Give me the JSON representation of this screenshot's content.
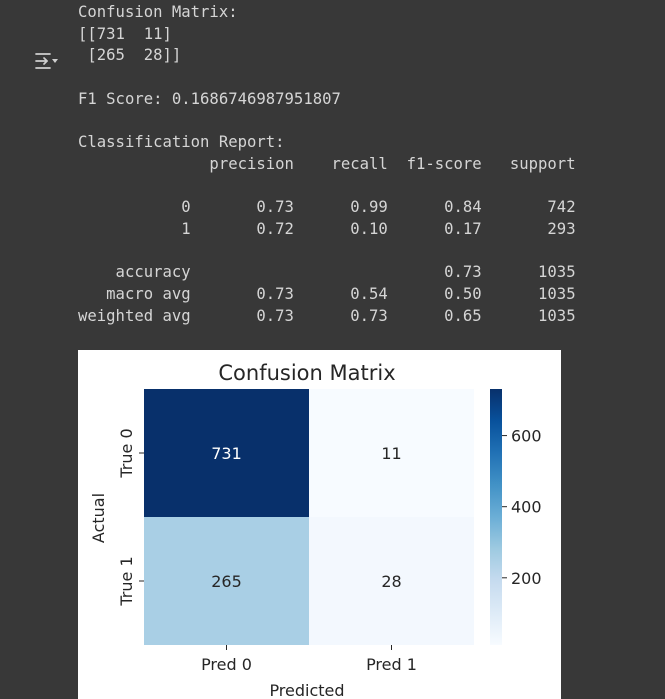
{
  "output_toggle": {
    "icon": "output-toggle-icon"
  },
  "output": {
    "cm_title": "Confusion Matrix:",
    "cm_row1": "[[731  11]",
    "cm_row2": " [265  28]]",
    "f1_line": "F1 Score: 0.1686746987951807",
    "report_title": "Classification Report:",
    "report_header": "              precision    recall  f1-score   support",
    "report_rows": [
      "           0       0.73      0.99      0.84       742",
      "           1       0.72      0.10      0.17       293"
    ],
    "report_summary": [
      "    accuracy                           0.73      1035",
      "   macro avg       0.73      0.54      0.50      1035",
      "weighted avg       0.73      0.73      0.65      1035"
    ]
  },
  "chart_data": {
    "type": "heatmap",
    "title": "Confusion Matrix",
    "xlabel": "Predicted",
    "ylabel": "Actual",
    "x_categories": [
      "Pred 0",
      "Pred 1"
    ],
    "y_categories": [
      "True 0",
      "True 1"
    ],
    "values": [
      [
        731,
        11
      ],
      [
        265,
        28
      ]
    ],
    "colormap": "Blues",
    "vmin": 11,
    "vmax": 731,
    "colorbar_ticks": [
      200,
      400,
      600
    ],
    "annotations": true,
    "colors": {
      "cell_731": "#08306b",
      "cell_11": "#f7fbff",
      "cell_265": "#a9cfe5",
      "cell_28": "#f3f8fe",
      "text_dark_cell": "#ffffff",
      "text_light_cell": "#262626"
    }
  }
}
